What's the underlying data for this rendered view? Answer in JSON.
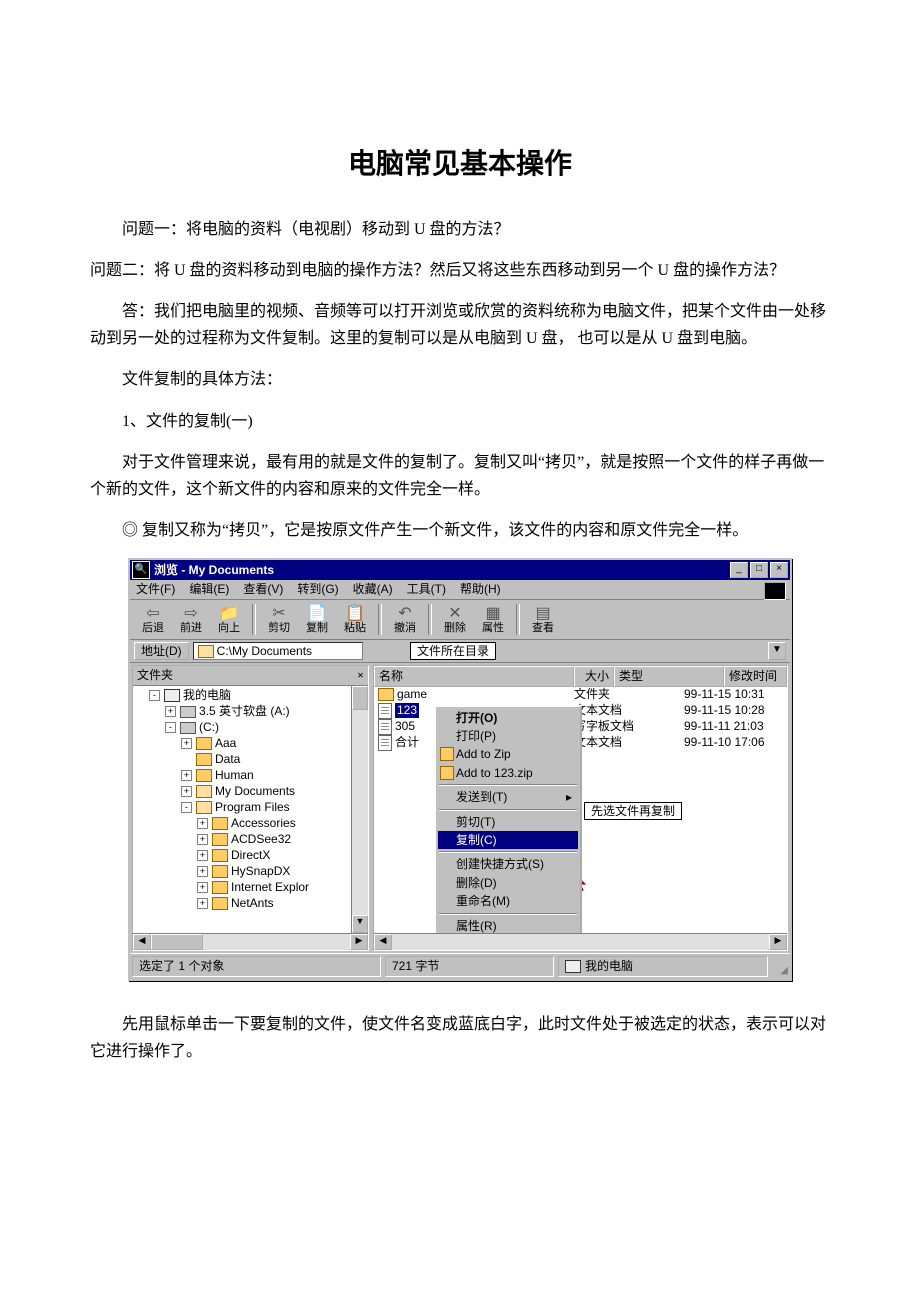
{
  "doc": {
    "title": "电脑常见基本操作",
    "p1": "问题一：将电脑的资料（电视剧）移动到 U 盘的方法？",
    "p2": "问题二：将 U 盘的资料移动到电脑的操作方法？然后又将这些东西移动到另一个 U 盘的操作方法？",
    "p3": "答：我们把电脑里的视频、音频等可以打开浏览或欣赏的资料统称为电脑文件，把某个文件由一处移动到另一处的过程称为文件复制。这里的复制可以是从电脑到 U 盘， 也可以是从 U 盘到电脑。",
    "p4": "文件复制的具体方法：",
    "p5": "1、文件的复制(一)",
    "p6": "　　对于文件管理来说，最有用的就是文件的复制了。复制又叫“拷贝”，就是按照一个文件的样子再做一个新的文件，这个新文件的内容和原来的文件完全一样。",
    "p7": "◎ 复制又称为“拷贝”，它是按原文件产生一个新文件，该文件的内容和原文件完全一样。",
    "p8": "　　先用鼠标单击一下要复制的文件，使文件名变成蓝底白字，此时文件处于被选定的状态，表示可以对它进行操作了。"
  },
  "win": {
    "title": "浏览 - My Documents",
    "menus": {
      "file": "文件(F)",
      "edit": "编辑(E)",
      "view": "查看(V)",
      "goto": "转到(G)",
      "fav": "收藏(A)",
      "tools": "工具(T)",
      "help": "帮助(H)"
    },
    "toolbar": {
      "back": "后退",
      "forward": "前进",
      "up": "向上",
      "cut": "剪切",
      "copy": "复制",
      "paste": "粘贴",
      "undo": "撤消",
      "delete": "删除",
      "prop": "属性",
      "view": "查看"
    },
    "address": {
      "label": "地址(D)",
      "path": "C:\\My Documents",
      "callout": "文件所在目录"
    },
    "leftTitle": "文件夹",
    "tree": {
      "r0": "我的电脑",
      "r1": "3.5 英寸软盘 (A:)",
      "r2": "(C:)",
      "r3": "Aaa",
      "r4": "Data",
      "r5": "Human",
      "r6": "My Documents",
      "r7": "Program Files",
      "r8": "Accessories",
      "r9": "ACDSee32",
      "r10": "DirectX",
      "r11": "HySnapDX",
      "r12": "Internet Explor",
      "r13": "NetAnts"
    },
    "cols": {
      "name": "名称",
      "size": "大小",
      "type": "类型",
      "time": "修改时间"
    },
    "rows": [
      {
        "n": "game",
        "t": "文件夹",
        "m": "99-11-15 10:31"
      },
      {
        "n": "123",
        "t": "文本文档",
        "m": "99-11-15 10:28"
      },
      {
        "n": "305",
        "t": "写字板文档",
        "m": "99-11-11 21:03"
      },
      {
        "n": "合计",
        "t": "文本文档",
        "m": "99-11-10 17:06"
      }
    ],
    "menu": {
      "open": "打开(O)",
      "print": "打印(P)",
      "addzip": "Add to Zip",
      "addzip2": "Add to 123.zip",
      "sendto": "发送到(T)",
      "cut": "剪切(T)",
      "copy": "复制(C)",
      "shortcut": "创建快捷方式(S)",
      "delete": "删除(D)",
      "rename": "重命名(M)",
      "prop": "属性(R)"
    },
    "callout2": "先选文件再复制",
    "status": {
      "p1": "选定了 1 个对象",
      "p2": "721 字节",
      "p3": "我的电脑"
    }
  }
}
